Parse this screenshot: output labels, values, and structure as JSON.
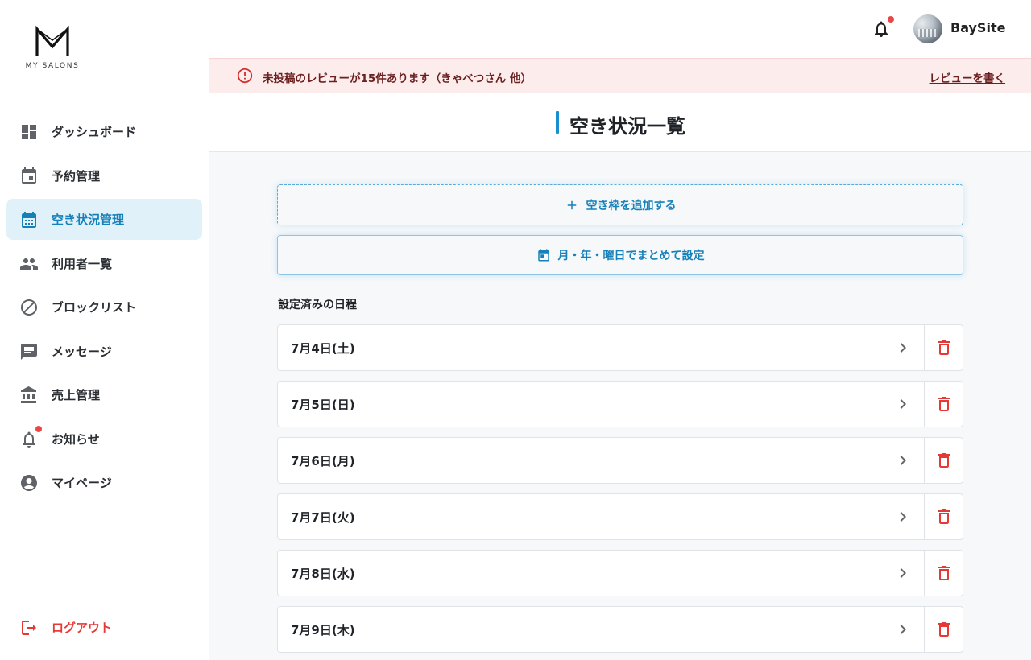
{
  "brand": {
    "logo_text": "MY SALONS",
    "accent_color": "#1a8fd0",
    "alert_color": "#e53935"
  },
  "sidebar": {
    "items": [
      {
        "label": "ダッシュボード",
        "icon": "dashboard-icon",
        "active": false
      },
      {
        "label": "予約管理",
        "icon": "calendar-event-icon",
        "active": false
      },
      {
        "label": "空き状況管理",
        "icon": "calendar-month-icon",
        "active": true
      },
      {
        "label": "利用者一覧",
        "icon": "people-icon",
        "active": false
      },
      {
        "label": "ブロックリスト",
        "icon": "block-icon",
        "active": false
      },
      {
        "label": "メッセージ",
        "icon": "message-icon",
        "active": false
      },
      {
        "label": "売上管理",
        "icon": "bank-icon",
        "active": false
      },
      {
        "label": "お知らせ",
        "icon": "bell-icon",
        "active": false,
        "badge": true
      },
      {
        "label": "マイページ",
        "icon": "account-circle-icon",
        "active": false
      }
    ],
    "logout_label": "ログアウト"
  },
  "header": {
    "username": "BaySite",
    "has_notification": true
  },
  "alert": {
    "message": "未投稿のレビューが15件あります（きゃべつさん 他）",
    "link_label": "レビューを書く"
  },
  "page": {
    "title": "空き状況一覧"
  },
  "actions": {
    "add_slot_label": "空き枠を追加する",
    "bulk_setting_label": "月・年・曜日でまとめて設定"
  },
  "schedule": {
    "section_label": "設定済みの日程",
    "dates": [
      "7月4日(土)",
      "7月5日(日)",
      "7月6日(月)",
      "7月7日(火)",
      "7月8日(水)",
      "7月9日(木)"
    ]
  }
}
